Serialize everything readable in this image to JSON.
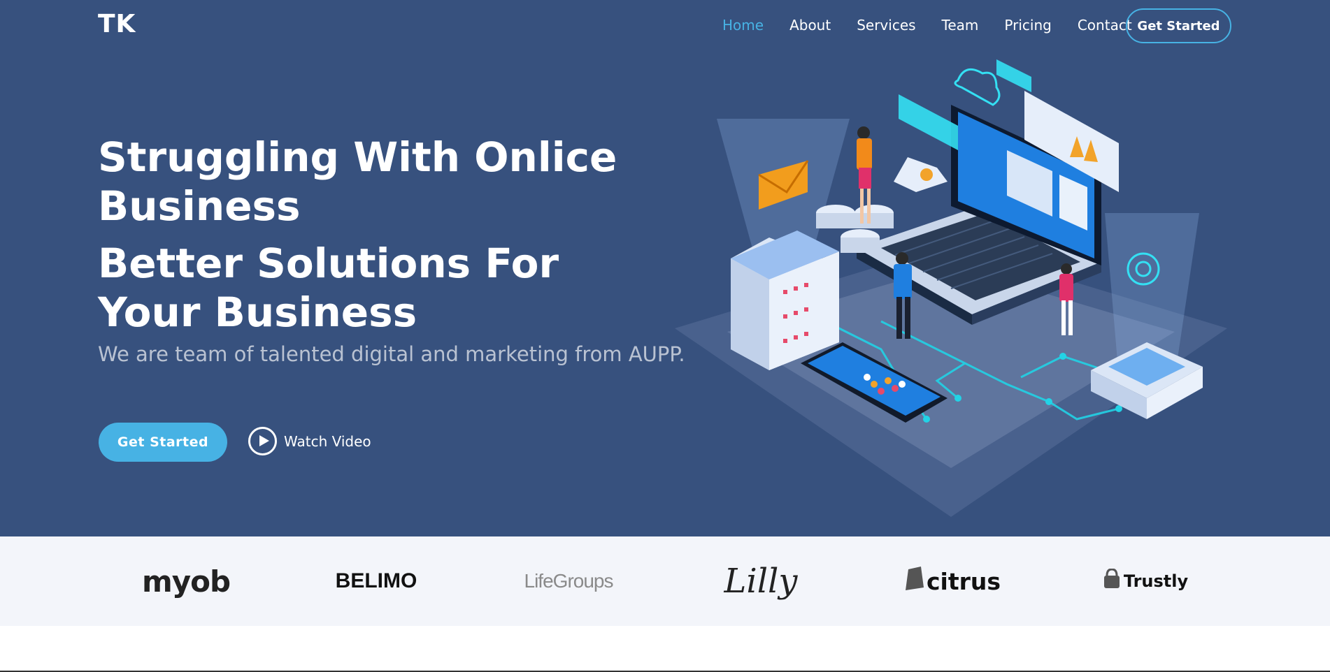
{
  "header": {
    "logo": "TK",
    "nav": [
      "Home",
      "About",
      "Services",
      "Team",
      "Pricing",
      "Contact"
    ],
    "active": "Home",
    "cta": "Get Started"
  },
  "hero": {
    "title_1": "Struggling With Onlice Business",
    "title_2": "Better Solutions For Your Business",
    "subtitle": "We are team of talented digital and marketing from AUPP.",
    "primary_button": "Get Started",
    "video_button": "Watch Video"
  },
  "clients": [
    "myob",
    "BELIMO",
    "LifeGroups",
    "Lilly",
    "citrus",
    "Trustly"
  ],
  "colors": {
    "hero_bg": "#37517e",
    "accent": "#47b2e4",
    "clients_bg": "#f3f5fa"
  },
  "icons": {
    "play": "play-circle-icon",
    "illustration": "isometric-tech-illustration"
  }
}
